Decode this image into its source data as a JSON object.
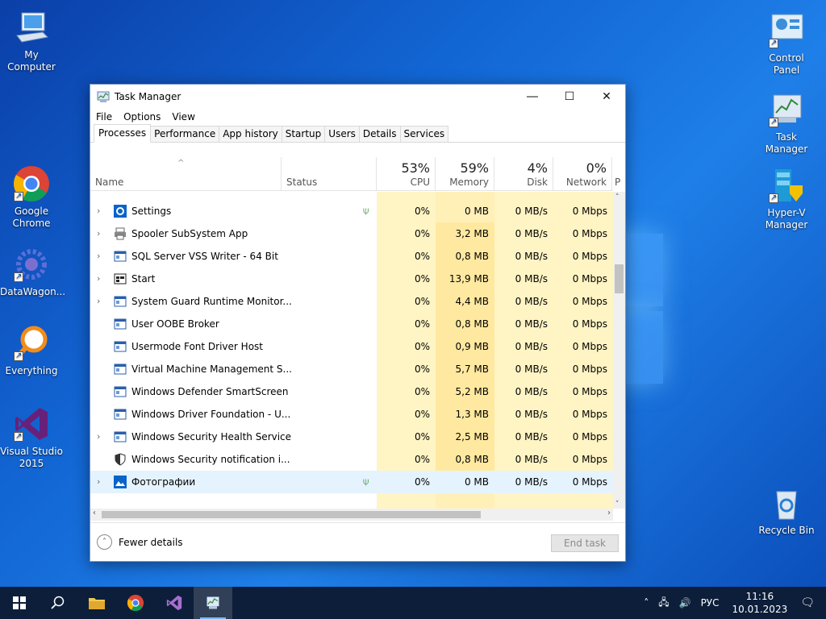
{
  "desktop": {
    "icons": [
      {
        "label": "My Computer"
      },
      {
        "label": "Google Chrome"
      },
      {
        "label": "DataWagon..."
      },
      {
        "label": "Everything"
      },
      {
        "label": "Visual Studio 2015"
      },
      {
        "label": "Control Panel"
      },
      {
        "label": "Task Manager"
      },
      {
        "label": "Hyper-V Manager"
      },
      {
        "label": "Recycle Bin"
      }
    ]
  },
  "window": {
    "title": "Task Manager",
    "menu": [
      "File",
      "Options",
      "View"
    ],
    "tabs": [
      "Processes",
      "Performance",
      "App history",
      "Startup",
      "Users",
      "Details",
      "Services"
    ],
    "active_tab": "Processes",
    "columns": {
      "name": "Name",
      "status": "Status",
      "cpu_pct": "53%",
      "cpu": "CPU",
      "memory_pct": "59%",
      "memory": "Memory",
      "disk_pct": "4%",
      "disk": "Disk",
      "network_pct": "0%",
      "network": "Network",
      "power": "P"
    },
    "rows": [
      {
        "name": "Settings",
        "expand": true,
        "icon": "gear-icon",
        "leaf": true,
        "cpu": "0%",
        "mem": "0 MB",
        "disk": "0 MB/s",
        "net": "0 Mbps"
      },
      {
        "name": "Spooler SubSystem App",
        "expand": true,
        "icon": "printer-icon",
        "leaf": false,
        "cpu": "0%",
        "mem": "3,2 MB",
        "disk": "0 MB/s",
        "net": "0 Mbps"
      },
      {
        "name": "SQL Server VSS Writer - 64 Bit",
        "expand": true,
        "icon": "service-icon",
        "leaf": false,
        "cpu": "0%",
        "mem": "0,8 MB",
        "disk": "0 MB/s",
        "net": "0 Mbps"
      },
      {
        "name": "Start",
        "expand": true,
        "icon": "start-icon",
        "leaf": false,
        "cpu": "0%",
        "mem": "13,9 MB",
        "disk": "0 MB/s",
        "net": "0 Mbps"
      },
      {
        "name": "System Guard Runtime Monitor...",
        "expand": true,
        "icon": "service-icon",
        "leaf": false,
        "cpu": "0%",
        "mem": "4,4 MB",
        "disk": "0 MB/s",
        "net": "0 Mbps"
      },
      {
        "name": "User OOBE Broker",
        "expand": false,
        "icon": "service-icon",
        "leaf": false,
        "cpu": "0%",
        "mem": "0,8 MB",
        "disk": "0 MB/s",
        "net": "0 Mbps"
      },
      {
        "name": "Usermode Font Driver Host",
        "expand": false,
        "icon": "service-icon",
        "leaf": false,
        "cpu": "0%",
        "mem": "0,9 MB",
        "disk": "0 MB/s",
        "net": "0 Mbps"
      },
      {
        "name": "Virtual Machine Management S...",
        "expand": false,
        "icon": "service-icon",
        "leaf": false,
        "cpu": "0%",
        "mem": "5,7 MB",
        "disk": "0 MB/s",
        "net": "0 Mbps"
      },
      {
        "name": "Windows Defender SmartScreen",
        "expand": false,
        "icon": "service-icon",
        "leaf": false,
        "cpu": "0%",
        "mem": "5,2 MB",
        "disk": "0 MB/s",
        "net": "0 Mbps"
      },
      {
        "name": "Windows Driver Foundation - U...",
        "expand": false,
        "icon": "service-icon",
        "leaf": false,
        "cpu": "0%",
        "mem": "1,3 MB",
        "disk": "0 MB/s",
        "net": "0 Mbps"
      },
      {
        "name": "Windows Security Health Service",
        "expand": true,
        "icon": "service-icon",
        "leaf": false,
        "cpu": "0%",
        "mem": "2,5 MB",
        "disk": "0 MB/s",
        "net": "0 Mbps"
      },
      {
        "name": "Windows Security notification i...",
        "expand": false,
        "icon": "shield-icon",
        "leaf": false,
        "cpu": "0%",
        "mem": "0,8 MB",
        "disk": "0 MB/s",
        "net": "0 Mbps"
      },
      {
        "name": "Фотографии",
        "expand": true,
        "icon": "photos-icon",
        "leaf": true,
        "cpu": "0%",
        "mem": "0 MB",
        "disk": "0 MB/s",
        "net": "0 Mbps"
      }
    ],
    "fewer_details": "Fewer details",
    "end_task": "End task"
  },
  "taskbar": {
    "lang": "РУС",
    "time": "11:16",
    "date": "10.01.2023"
  }
}
